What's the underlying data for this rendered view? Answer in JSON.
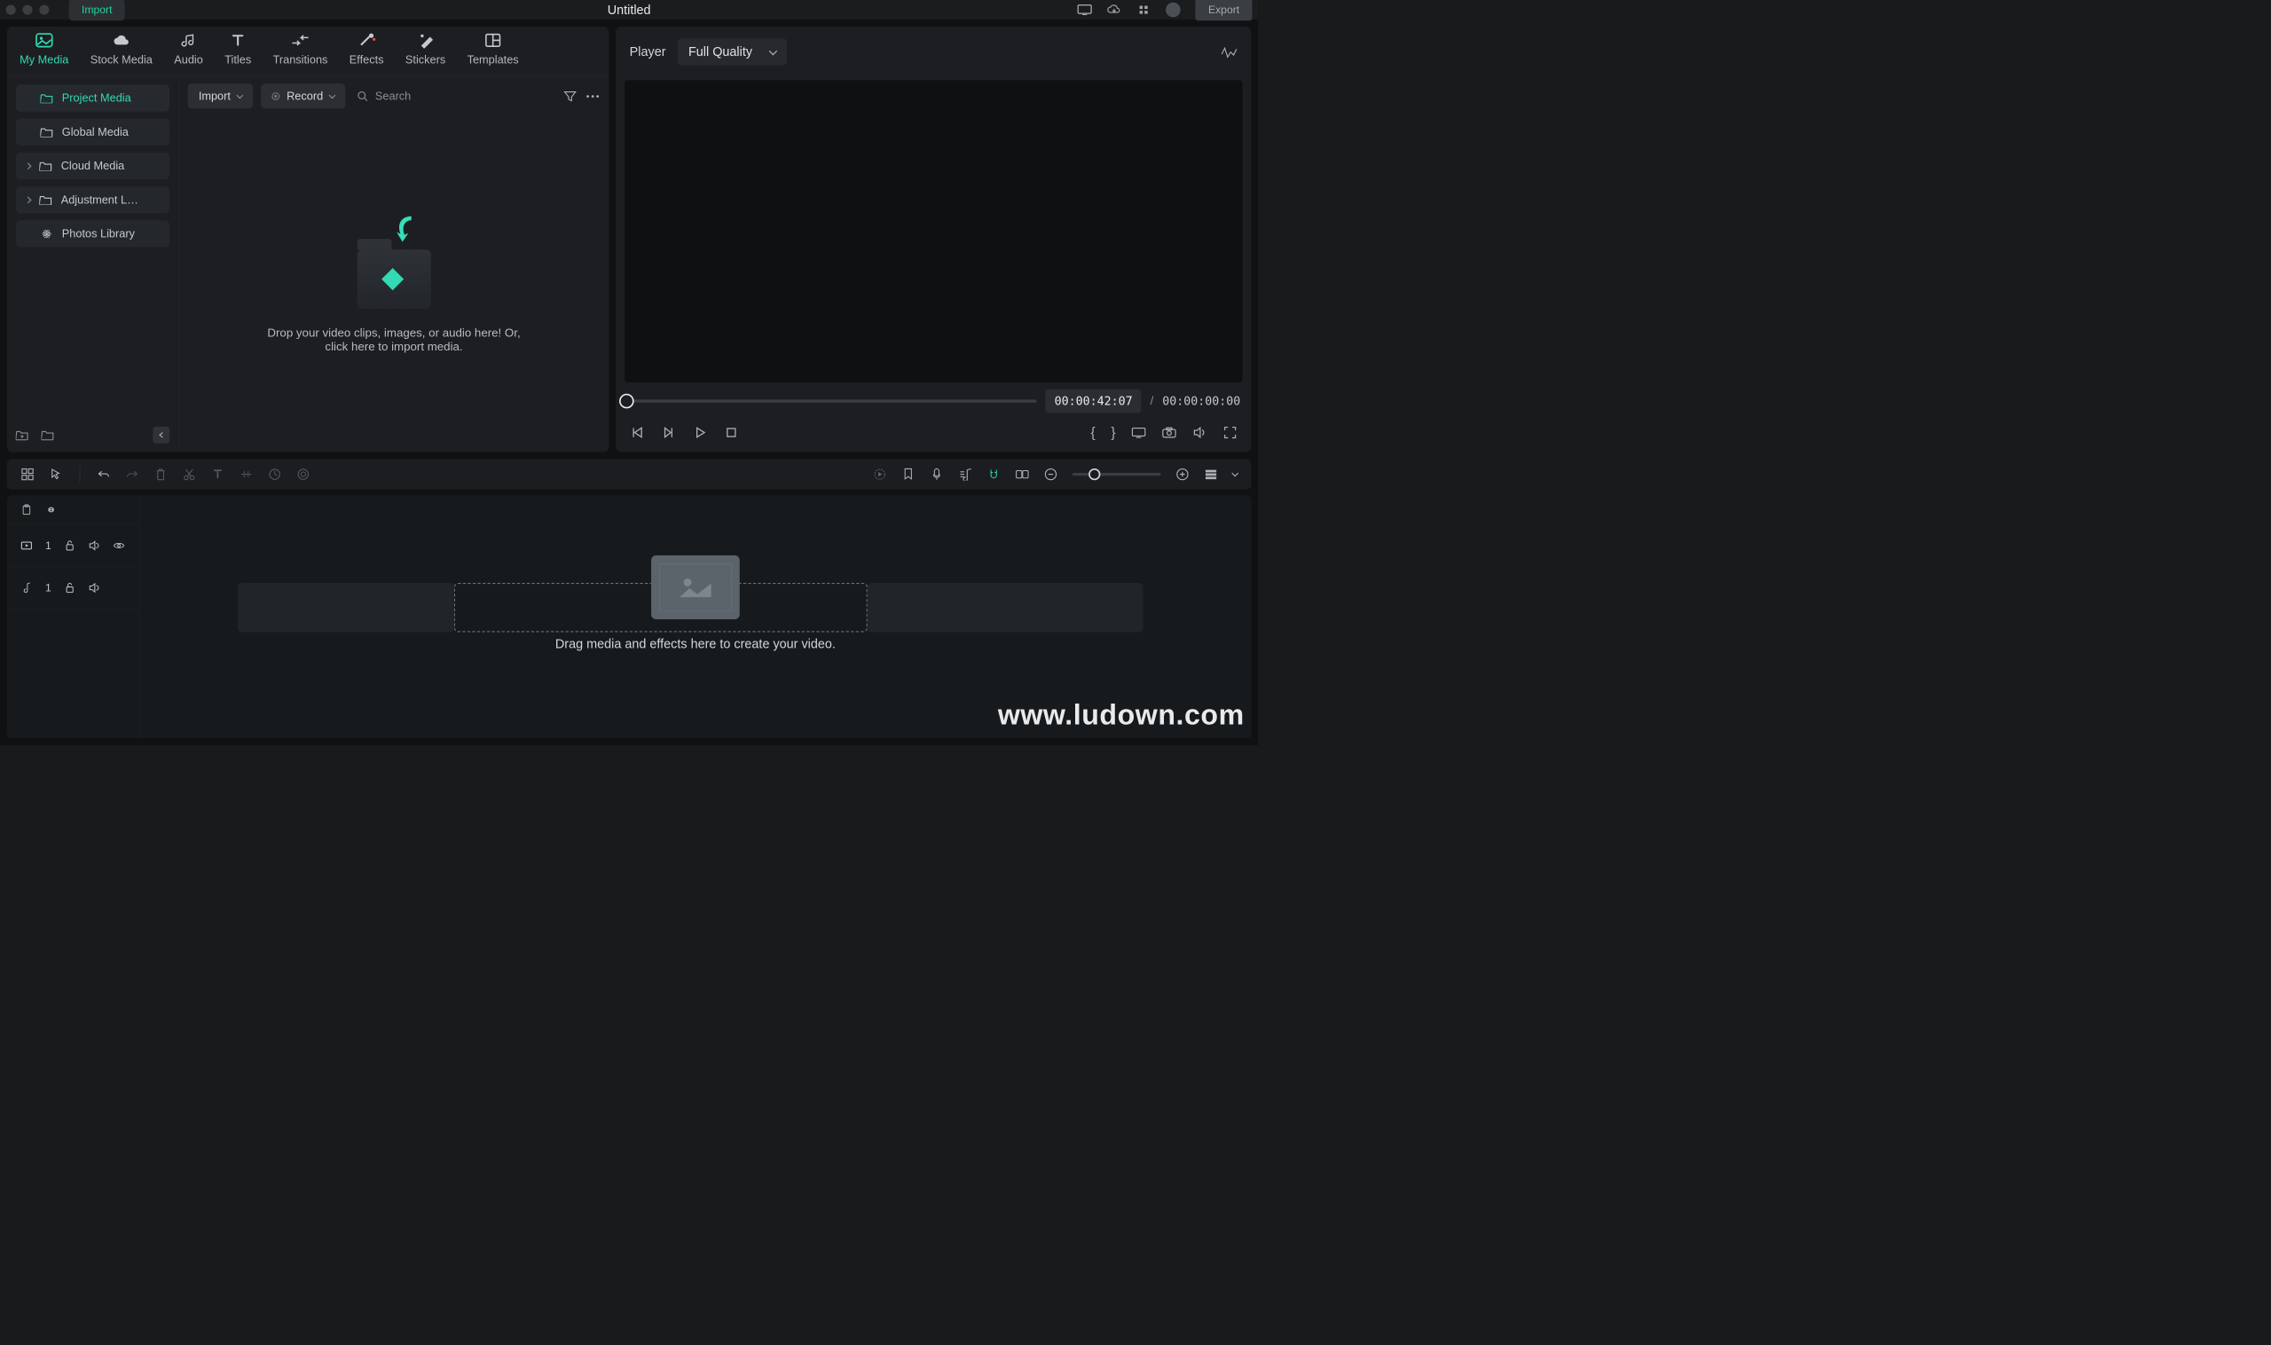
{
  "titlebar": {
    "import": "Import",
    "title": "Untitled",
    "export": "Export"
  },
  "tabs": [
    {
      "id": "my-media",
      "label": "My Media"
    },
    {
      "id": "stock-media",
      "label": "Stock Media"
    },
    {
      "id": "audio",
      "label": "Audio"
    },
    {
      "id": "titles",
      "label": "Titles"
    },
    {
      "id": "transitions",
      "label": "Transitions"
    },
    {
      "id": "effects",
      "label": "Effects"
    },
    {
      "id": "stickers",
      "label": "Stickers"
    },
    {
      "id": "templates",
      "label": "Templates"
    }
  ],
  "sidebar": {
    "items": [
      {
        "label": "Project Media",
        "active": true,
        "icon": "folder"
      },
      {
        "label": "Global Media",
        "icon": "folder"
      },
      {
        "label": "Cloud Media",
        "icon": "folder",
        "expandable": true
      },
      {
        "label": "Adjustment L…",
        "icon": "folder",
        "expandable": true
      },
      {
        "label": "Photos Library",
        "icon": "atom"
      }
    ]
  },
  "media": {
    "import_btn": "Import",
    "record_btn": "Record",
    "search_placeholder": "Search",
    "drop_hint_1": "Drop your video clips, images, or audio here! Or,",
    "drop_hint_2": "click here to import media."
  },
  "player": {
    "title": "Player",
    "quality": "Full Quality",
    "current_tc": "00:00:42:07",
    "sep": "/",
    "total_tc": "00:00:00:00"
  },
  "timeline": {
    "video_track_num": "1",
    "audio_track_num": "1",
    "drop_hint": "Drag media and effects here to create your video."
  },
  "watermark": "www.ludown.com"
}
